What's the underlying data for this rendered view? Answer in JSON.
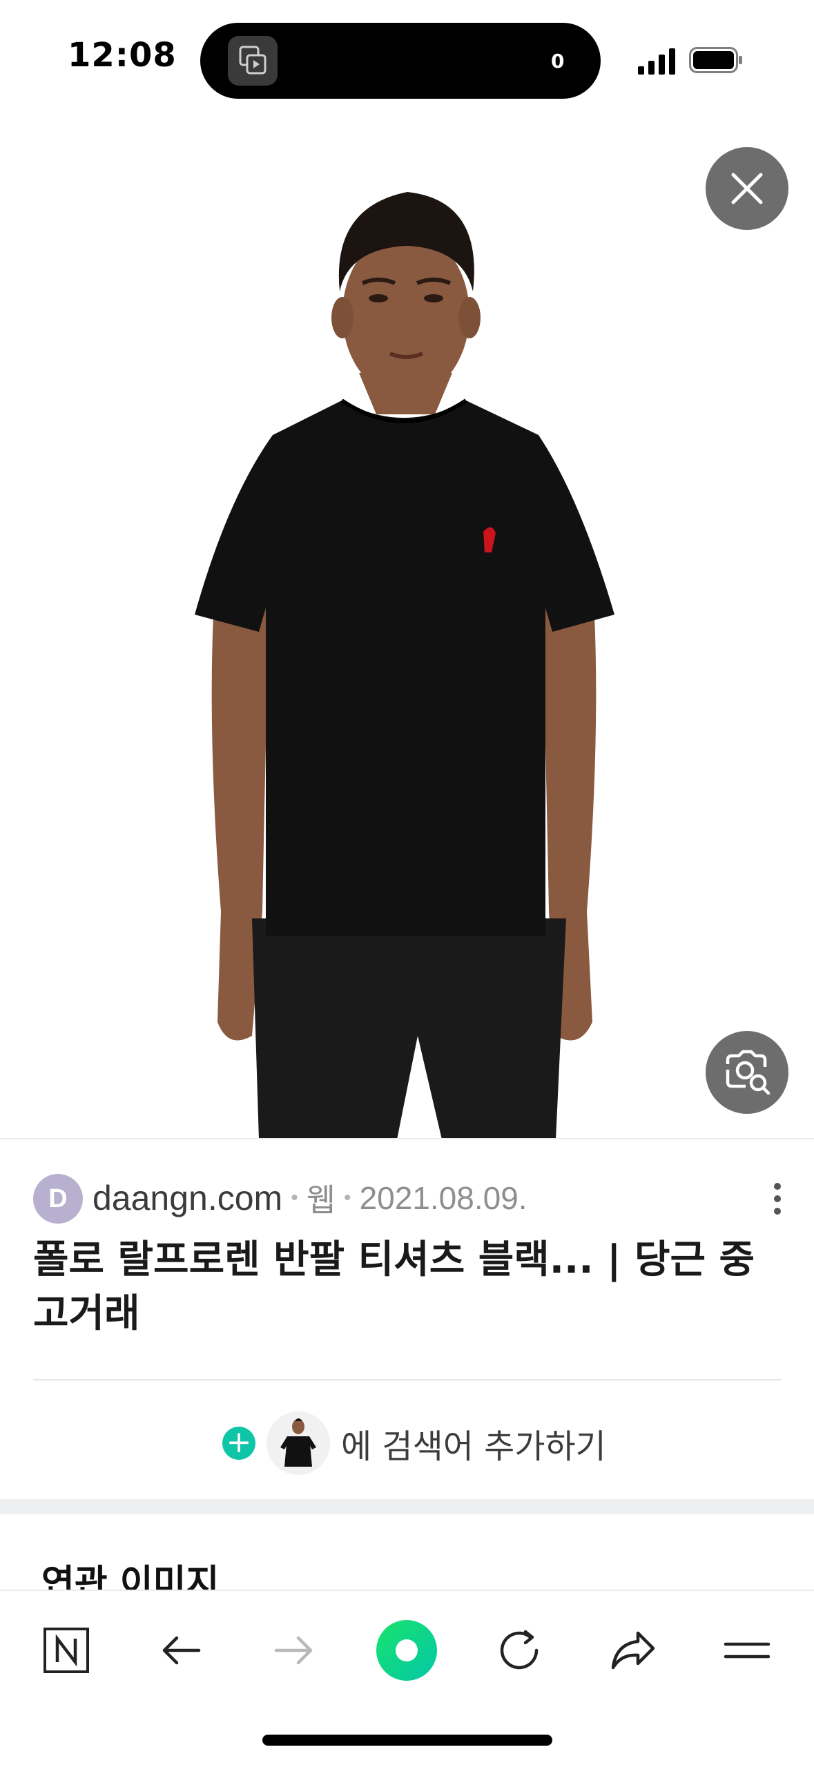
{
  "status_bar": {
    "time": "12:08",
    "island_count": "0"
  },
  "viewer": {
    "image_subject": "model-wearing-black-tshirt"
  },
  "result": {
    "favicon_letter": "D",
    "domain": "daangn.com",
    "type": "웹",
    "date": "2021.08.09.",
    "title": "폴로 랄프로렌 반팔 티셔츠 블랙... | 당근 중고거래"
  },
  "add_search": {
    "label": "에 검색어 추가하기"
  },
  "related": {
    "heading": "연관 이미지"
  },
  "colors": {
    "accent_green": "#03c75a",
    "plus_teal": "#10c4a8"
  }
}
